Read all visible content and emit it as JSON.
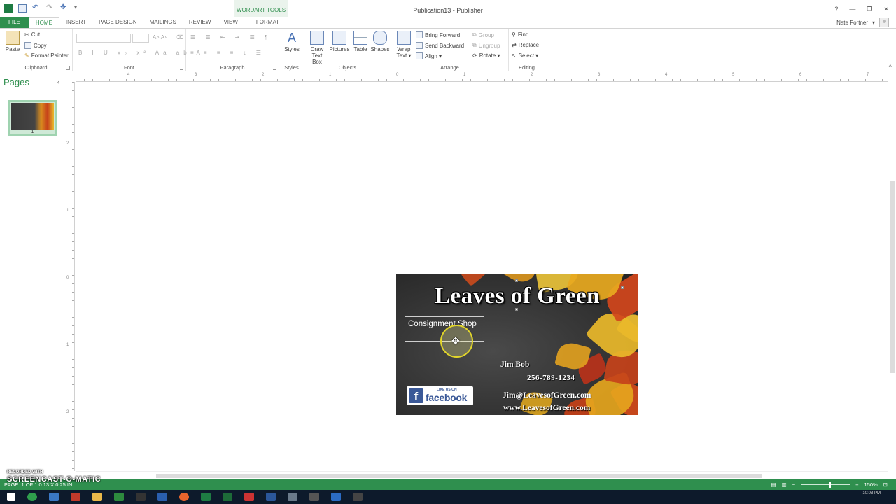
{
  "window": {
    "title": "Publication13 - Publisher",
    "contextual_tab": "WORDART TOOLS",
    "controls": [
      "?",
      "—",
      "❐",
      "✕"
    ]
  },
  "tabs": [
    "FILE",
    "HOME",
    "INSERT",
    "PAGE DESIGN",
    "MAILINGS",
    "REVIEW",
    "VIEW",
    "FORMAT"
  ],
  "user": {
    "name": "Nate Fortner"
  },
  "ribbon": {
    "clipboard": {
      "label": "Clipboard",
      "paste": "Paste",
      "cut": "Cut",
      "copy": "Copy",
      "format_painter": "Format Painter"
    },
    "font": {
      "label": "Font"
    },
    "paragraph": {
      "label": "Paragraph"
    },
    "styles": {
      "label": "Styles",
      "button": "Styles"
    },
    "objects": {
      "label": "Objects",
      "draw_text_box_1": "Draw",
      "draw_text_box_2": "Text Box",
      "pictures": "Pictures",
      "table": "Table",
      "shapes": "Shapes"
    },
    "arrange": {
      "label": "Arrange",
      "wrap_text_1": "Wrap",
      "wrap_text_2": "Text ▾",
      "bring_forward": "Bring Forward",
      "send_backward": "Send Backward",
      "align": "Align ▾",
      "group": "Group",
      "ungroup": "Ungroup",
      "rotate": "Rotate ▾"
    },
    "editing": {
      "label": "Editing",
      "find": "Find",
      "replace": "Replace",
      "select": "Select ▾"
    }
  },
  "pages_pane": {
    "title": "Pages",
    "page_number": "1"
  },
  "ruler": {
    "h_labels": [
      "4",
      "3",
      "2",
      "1",
      "0",
      "1",
      "2",
      "3",
      "4",
      "5",
      "6",
      "7"
    ],
    "v_labels": [
      "2",
      "1",
      "0",
      "1",
      "2"
    ]
  },
  "card": {
    "title": "Leaves of Green",
    "subtitle": "Consignment Shop",
    "name": "Jim Bob",
    "phone": "256-789-1234",
    "email": "Jim@LeavesofGreen.com",
    "website": "www.LeavesofGreen.com",
    "facebook_like": "LIKE US ON",
    "facebook_word": "facebook"
  },
  "statusbar": {
    "left": "PAGE: 1 OF 1    0.13 X 0.25 IN.",
    "zoom": "150%"
  },
  "watermark": {
    "line1": "RECORDED WITH",
    "line2": "SCREENCAST-O-MATIC"
  },
  "clock": "10:03 PM",
  "colors": {
    "accent": "#2f8f4e",
    "canvas": "#ffffff",
    "taskbar": "#0d1a2b"
  }
}
